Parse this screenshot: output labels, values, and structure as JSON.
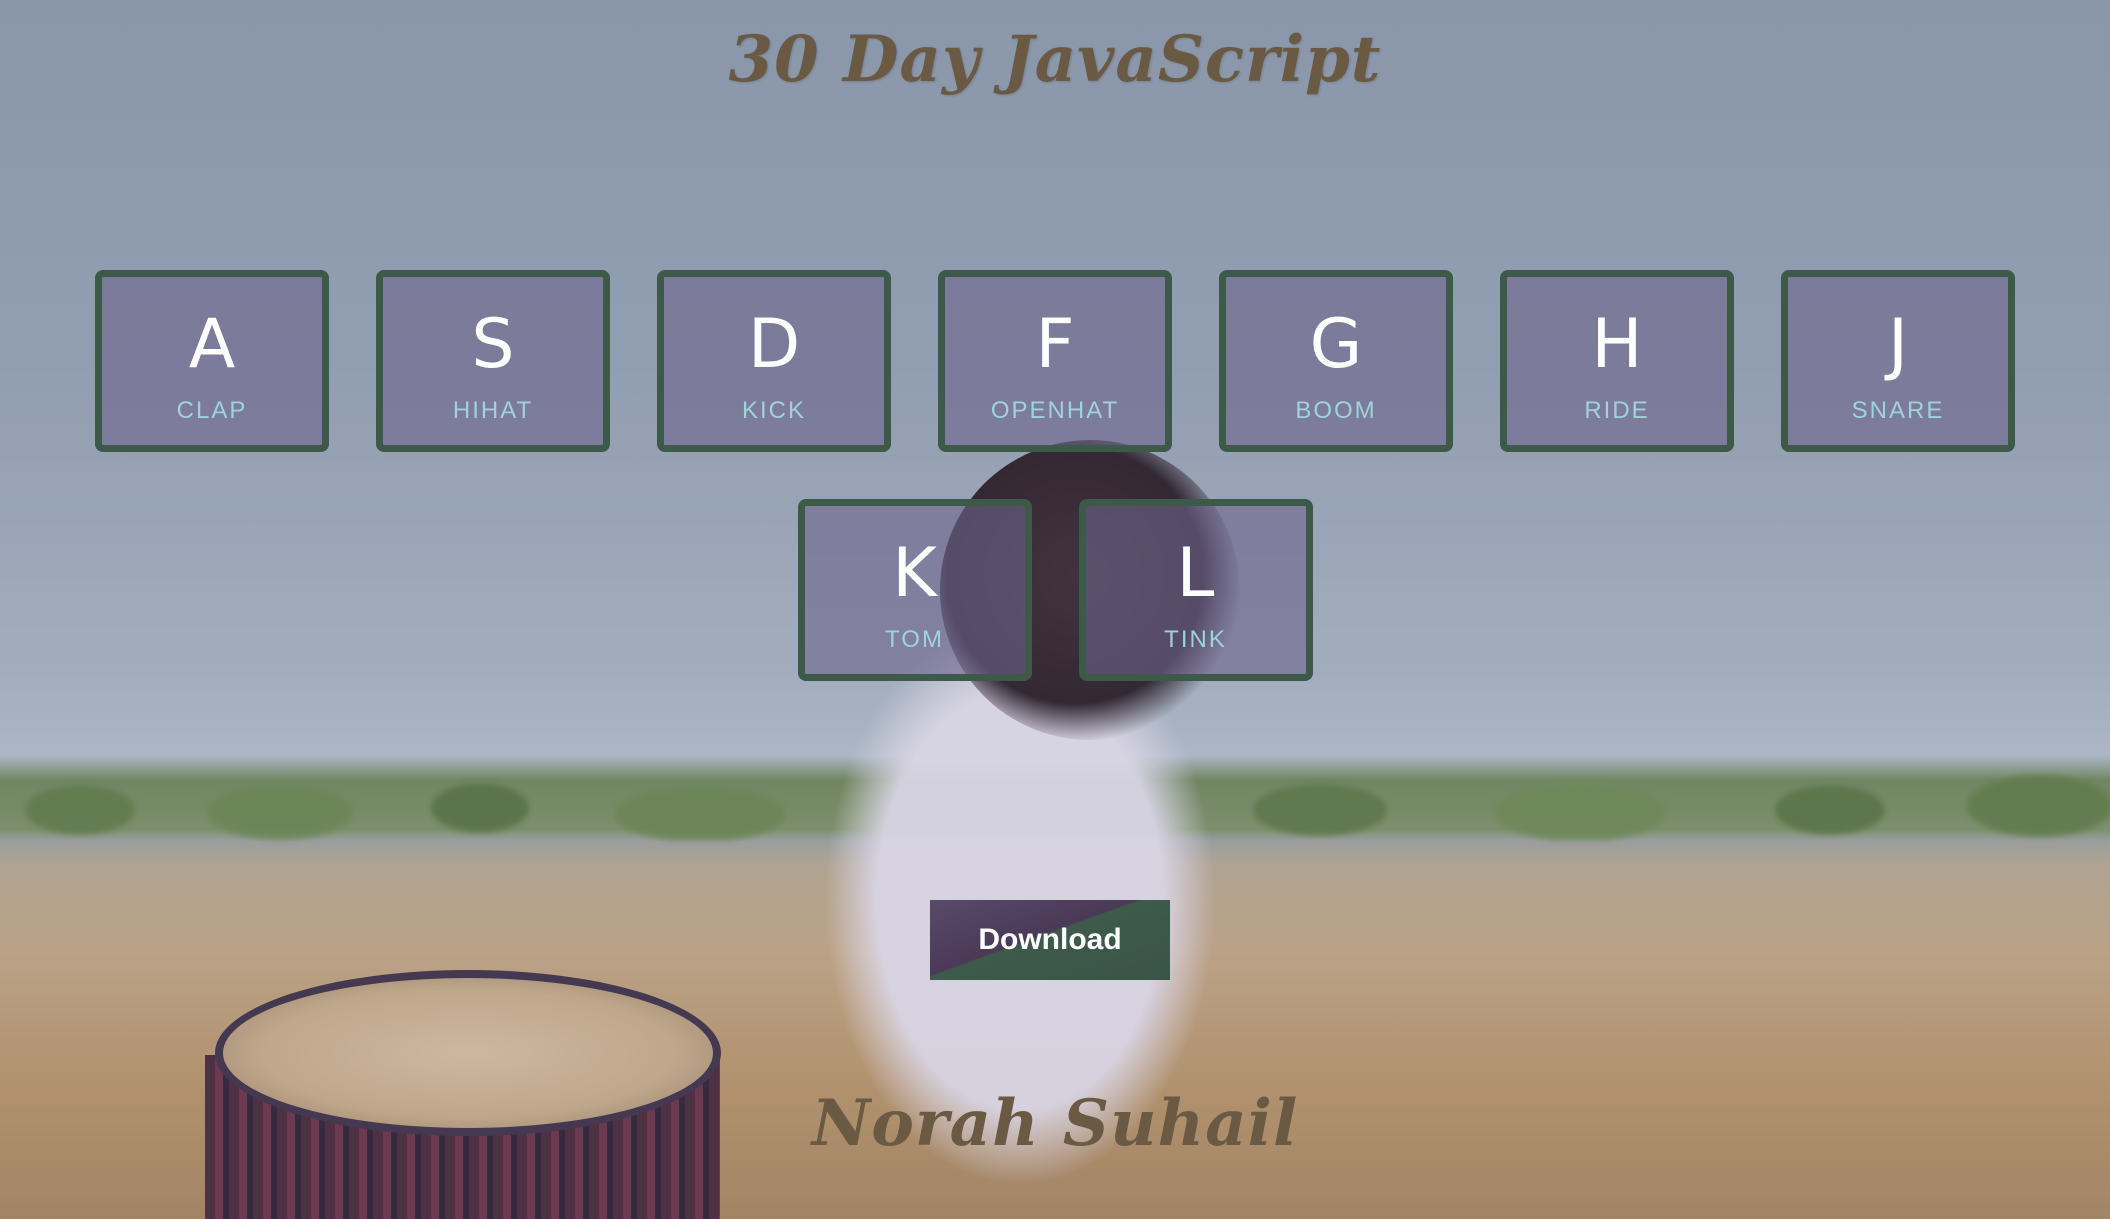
{
  "header": {
    "title": "30 Day JavaScript"
  },
  "keys": [
    {
      "letter": "A",
      "sound": "CLAP"
    },
    {
      "letter": "S",
      "sound": "HIHAT"
    },
    {
      "letter": "D",
      "sound": "KICK"
    },
    {
      "letter": "F",
      "sound": "OPENHAT"
    },
    {
      "letter": "G",
      "sound": "BOOM"
    },
    {
      "letter": "H",
      "sound": "RIDE"
    },
    {
      "letter": "J",
      "sound": "SNARE"
    },
    {
      "letter": "K",
      "sound": "TOM"
    },
    {
      "letter": "L",
      "sound": "TINK"
    }
  ],
  "download": {
    "label": "Download"
  },
  "footer": {
    "author": "Norah Suhail"
  },
  "colors": {
    "key_border": "#3d5a48",
    "key_sound_text": "#9ed3da",
    "title_text": "#6a5a44"
  }
}
